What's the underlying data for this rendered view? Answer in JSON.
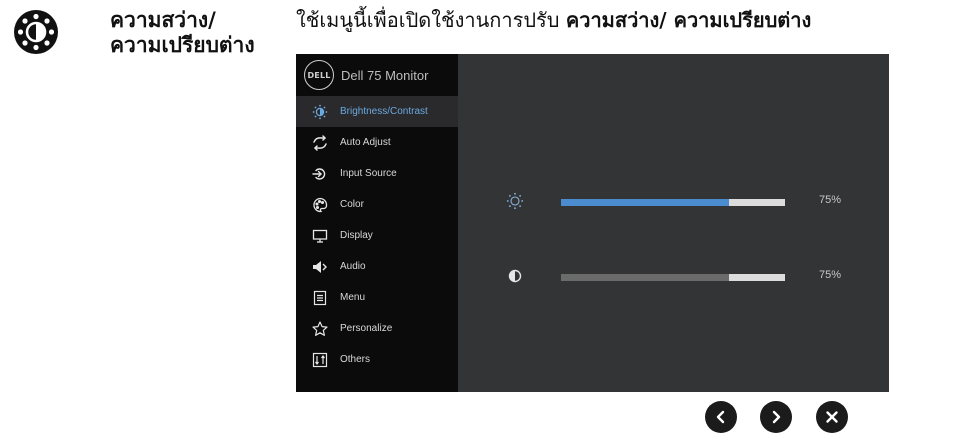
{
  "section": {
    "icon": "brightness-contrast-icon",
    "title": "ความสว่าง/ ความเปรียบต่าง"
  },
  "description": {
    "prefix": "ใช้เมนูนี้เพื่อเปิดใช้งานการปรับ",
    "bold": "ความสว่าง/ ความเปรียบต่าง"
  },
  "osd": {
    "model": "Dell 75 Monitor",
    "logo_text": "DELL",
    "menu_items": [
      {
        "label": "Brightness/Contrast",
        "icon": "brightness-contrast-icon",
        "active": true
      },
      {
        "label": "Auto Adjust",
        "icon": "auto-adjust-icon",
        "active": false
      },
      {
        "label": "Input Source",
        "icon": "input-source-icon",
        "active": false
      },
      {
        "label": "Color",
        "icon": "color-palette-icon",
        "active": false
      },
      {
        "label": "Display",
        "icon": "display-icon",
        "active": false
      },
      {
        "label": "Audio",
        "icon": "speaker-icon",
        "active": false
      },
      {
        "label": "Menu",
        "icon": "menu-icon",
        "active": false
      },
      {
        "label": "Personalize",
        "icon": "star-icon",
        "active": false
      },
      {
        "label": "Others",
        "icon": "others-icon",
        "active": false
      }
    ],
    "brightness": {
      "value": 75,
      "label": "75%",
      "color": "#4a8ccf"
    },
    "contrast": {
      "value": 75,
      "label": "75%",
      "color": "#6b6b6b"
    }
  },
  "nav": [
    "previous-button",
    "next-button",
    "close-button"
  ],
  "colors": {
    "accent": "#6aa8e0",
    "osd_bg": "#333435",
    "menu_bg": "#0b0b0b"
  }
}
